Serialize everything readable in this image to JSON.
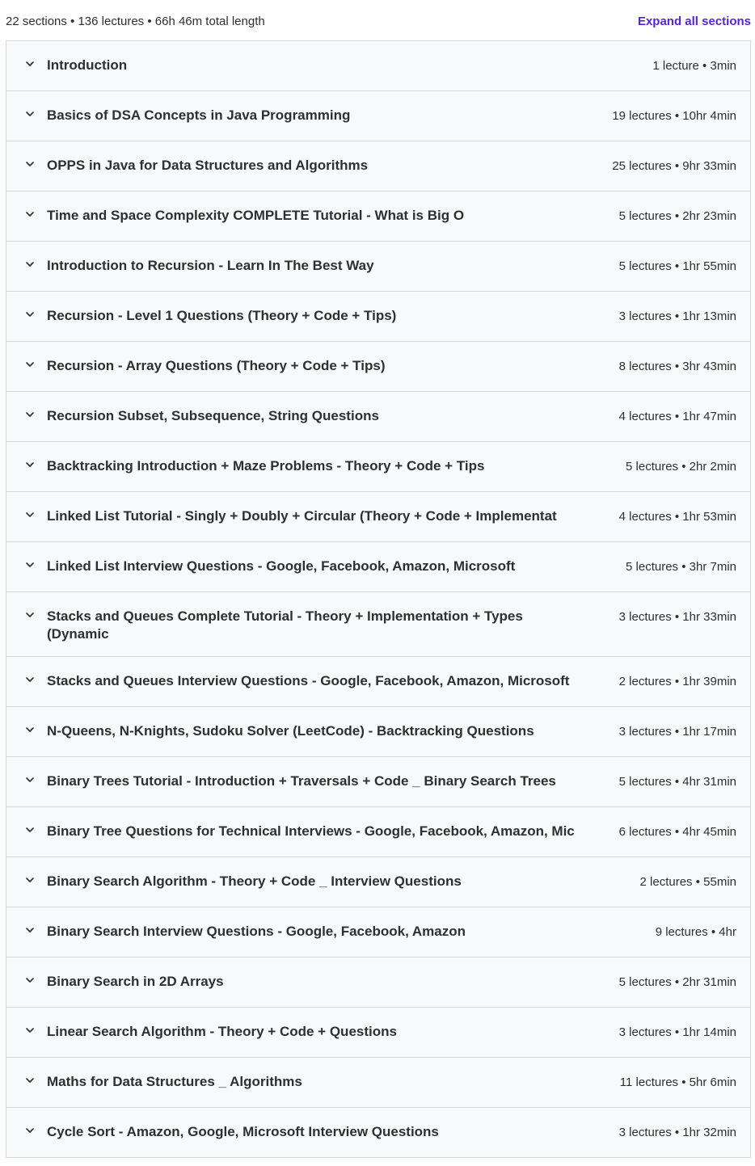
{
  "header": {
    "summary": "22 sections • 136 lectures • 66h 46m total length",
    "expand_all_label": "Expand all sections"
  },
  "colors": {
    "accent": "#5624d0",
    "row_background": "#f7f9fa",
    "border": "#d1d7dc",
    "text": "#2d2f31"
  },
  "icons": {
    "section_toggle": "chevron-down-icon"
  },
  "sections": [
    {
      "title": "Introduction",
      "meta": "1 lecture • 3min"
    },
    {
      "title": "Basics of DSA Concepts in Java Programming",
      "meta": "19 lectures • 10hr 4min"
    },
    {
      "title": "OPPS in Java for Data Structures and Algorithms",
      "meta": "25 lectures • 9hr 33min"
    },
    {
      "title": "Time and Space Complexity COMPLETE Tutorial - What is Big O",
      "meta": "5 lectures • 2hr 23min"
    },
    {
      "title": "Introduction to Recursion - Learn In The Best Way",
      "meta": "5 lectures • 1hr 55min"
    },
    {
      "title": "Recursion - Level 1 Questions (Theory + Code + Tips)",
      "meta": "3 lectures • 1hr 13min"
    },
    {
      "title": "Recursion - Array Questions (Theory + Code + Tips)",
      "meta": "8 lectures • 3hr 43min"
    },
    {
      "title": "Recursion Subset, Subsequence, String Questions",
      "meta": "4 lectures • 1hr 47min"
    },
    {
      "title": "Backtracking Introduction + Maze Problems - Theory + Code + Tips",
      "meta": "5 lectures • 2hr 2min"
    },
    {
      "title": "Linked List Tutorial - Singly + Doubly + Circular (Theory + Code + Implementat",
      "meta": "4 lectures • 1hr 53min"
    },
    {
      "title": "Linked List Interview Questions - Google, Facebook, Amazon, Microsoft",
      "meta": "5 lectures • 3hr 7min"
    },
    {
      "title": "Stacks and Queues Complete Tutorial - Theory + Implementation + Types (Dynamic",
      "meta": "3 lectures • 1hr 33min"
    },
    {
      "title": "Stacks and Queues Interview Questions - Google, Facebook, Amazon, Microsoft",
      "meta": "2 lectures • 1hr 39min"
    },
    {
      "title": "N-Queens, N-Knights, Sudoku Solver (LeetCode) - Backtracking Questions",
      "meta": "3 lectures • 1hr 17min"
    },
    {
      "title": "Binary Trees Tutorial - Introduction + Traversals + Code _ Binary Search Trees",
      "meta": "5 lectures • 4hr 31min"
    },
    {
      "title": "Binary Tree Questions for Technical Interviews - Google, Facebook, Amazon, Mic",
      "meta": "6 lectures • 4hr 45min"
    },
    {
      "title": "Binary Search Algorithm - Theory + Code _ Interview Questions",
      "meta": "2 lectures • 55min"
    },
    {
      "title": "Binary Search Interview Questions - Google, Facebook, Amazon",
      "meta": "9 lectures • 4hr"
    },
    {
      "title": "Binary Search in 2D Arrays",
      "meta": "5 lectures • 2hr 31min"
    },
    {
      "title": "Linear Search Algorithm - Theory + Code + Questions",
      "meta": "3 lectures • 1hr 14min"
    },
    {
      "title": "Maths for Data Structures _ Algorithms",
      "meta": "11 lectures • 5hr 6min"
    },
    {
      "title": "Cycle Sort - Amazon, Google, Microsoft Interview Questions",
      "meta": "3 lectures • 1hr 32min"
    }
  ]
}
